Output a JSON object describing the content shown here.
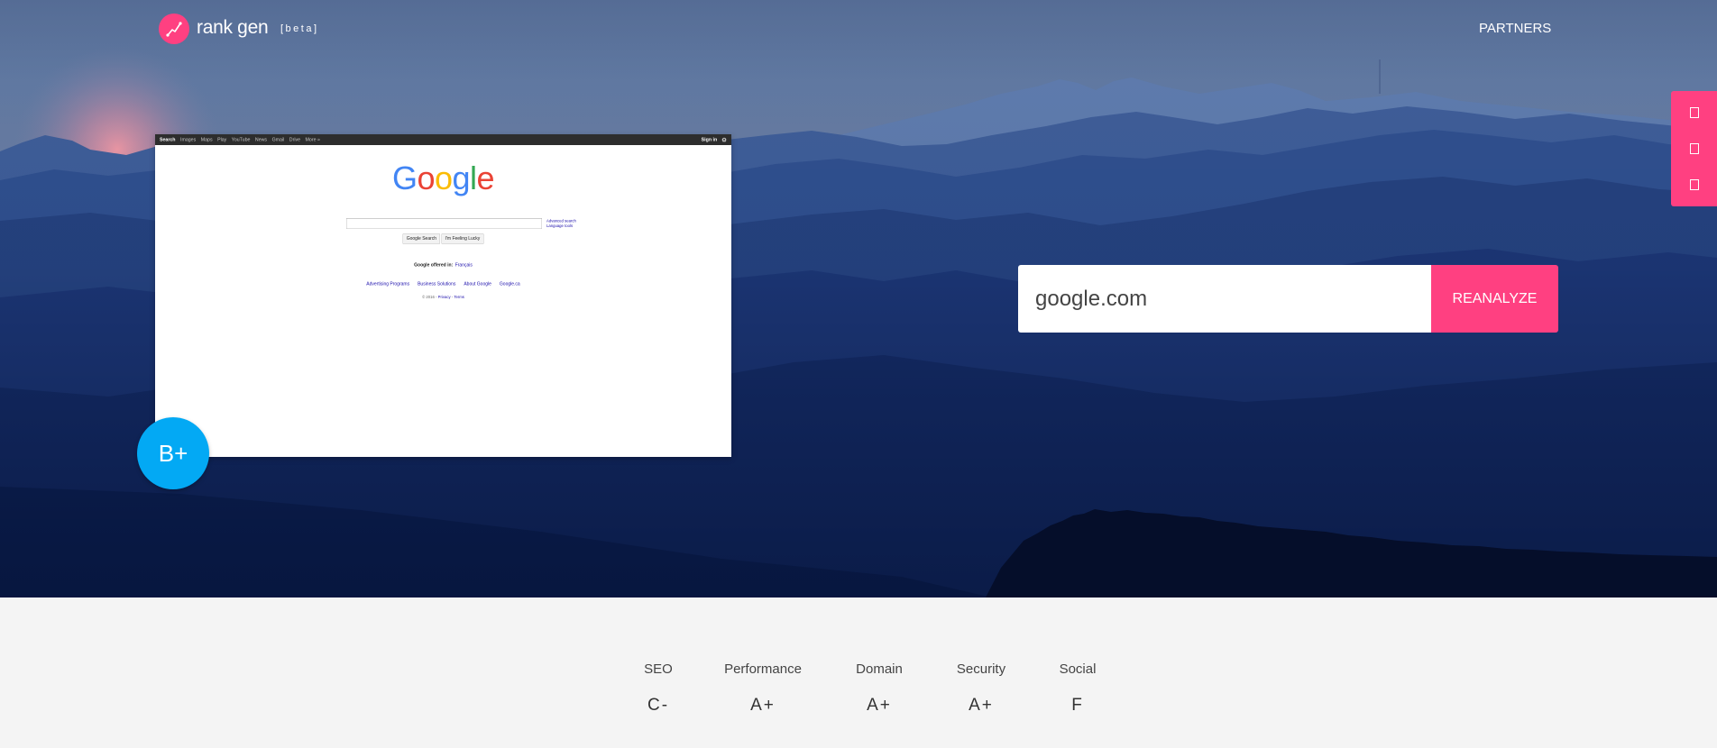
{
  "header": {
    "brand": "rank gen",
    "beta": "[beta]",
    "partners": "PARTNERS",
    "logo_icon": "trend-line-icon"
  },
  "side_panel": {
    "icons": [
      "glyph-box-icon",
      "glyph-box-icon",
      "glyph-box-icon"
    ]
  },
  "preview": {
    "topbar": {
      "items": [
        "Search",
        "Images",
        "Maps",
        "Play",
        "YouTube",
        "News",
        "Gmail",
        "Drive",
        "More »"
      ],
      "sign_in": "Sign in",
      "settings_icon": "gear-icon"
    },
    "logo_letters": [
      "G",
      "o",
      "o",
      "g",
      "l",
      "e"
    ],
    "search_links": [
      "Advanced search",
      "Language tools"
    ],
    "buttons": [
      "Google Search",
      "I'm Feeling Lucky"
    ],
    "offered_in": "Google offered in:",
    "language": "Français",
    "footer_links": [
      "Advertising Programs",
      "Business Solutions",
      "About Google",
      "Google.ca"
    ],
    "copyright": "© 2016 -",
    "privacy": "Privacy",
    "separator": "-",
    "terms": "Terms"
  },
  "overall_grade": "B+",
  "search": {
    "value": "google.com",
    "button": "REANALYZE"
  },
  "scores": [
    {
      "label": "SEO",
      "grade": "C-"
    },
    {
      "label": "Performance",
      "grade": "A+"
    },
    {
      "label": "Domain",
      "grade": "A+"
    },
    {
      "label": "Security",
      "grade": "A+"
    },
    {
      "label": "Social",
      "grade": "F"
    }
  ],
  "colors": {
    "accent": "#ff4081",
    "grade_badge": "#03a9f4",
    "scores_background": "#f4f4f4"
  }
}
